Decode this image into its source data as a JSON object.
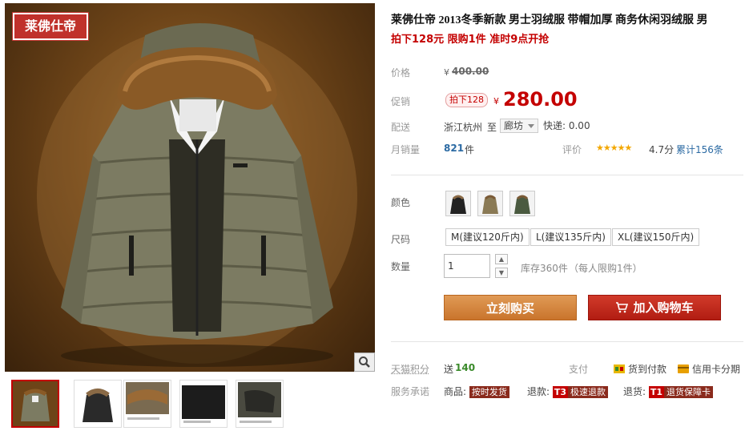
{
  "brand_badge": "莱佛仕帝",
  "product": {
    "title": "莱佛仕帝 2013冬季新款 男士羽绒服 带帽加厚 商务休闲羽绒服 男",
    "subtitle": "拍下128元 限购1件 准时9点开抢"
  },
  "price": {
    "label": "价格",
    "currency": "¥",
    "original": "400.00",
    "promo_label": "促销",
    "promo_tag": "拍下128",
    "promo_price": "280.00"
  },
  "shipping": {
    "label": "配送",
    "from": "浙江杭州",
    "to_word": "至",
    "destination": "廊坊",
    "fee_label": "快递: 0.00"
  },
  "sales": {
    "label": "月销量",
    "count": "821",
    "unit": "件",
    "rating_label": "评价",
    "stars": "★★★★★",
    "score": "4.7分",
    "reviews": "累计156条"
  },
  "color": {
    "label": "颜色",
    "swatches": [
      "black",
      "khaki",
      "army-green"
    ]
  },
  "size": {
    "label": "尺码",
    "options": [
      "M(建议120斤内)",
      "L(建议135斤内)",
      "XL(建议150斤内)"
    ]
  },
  "quantity": {
    "label": "数量",
    "value": "1",
    "stock": "库存360件",
    "limit": "（每人限购1件）"
  },
  "actions": {
    "buy_now": "立刻购买",
    "add_to_cart": "加入购物车"
  },
  "points": {
    "label": "天猫积分",
    "prefix": "送",
    "value": "140",
    "pay_label": "支付",
    "cod": "货到付款",
    "installment": "信用卡分期"
  },
  "service": {
    "label": "服务承诺",
    "goods_label": "商品:",
    "goods_tag": "按时发货",
    "refund_label": "退款:",
    "refund_code": "T3",
    "refund_tag": "极速退款",
    "return_label": "退货:",
    "return_code": "T1",
    "return_tag": "退货保障卡"
  },
  "colors": {
    "accent_red": "#c40000",
    "buy_orange": "#c9742c",
    "cart_red": "#b11d12",
    "star_gold": "#f3a700"
  }
}
